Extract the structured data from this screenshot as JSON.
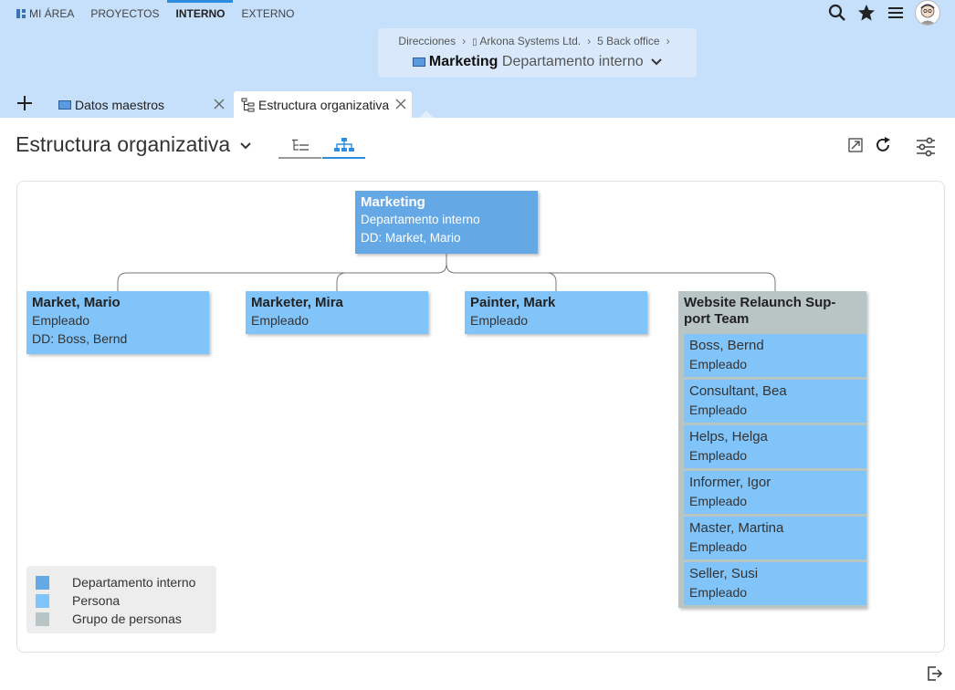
{
  "topnav": {
    "items": [
      {
        "label": "MI ÁREA",
        "active": false
      },
      {
        "label": "PROYECTOS",
        "active": false
      },
      {
        "label": "INTERNO",
        "active": true
      },
      {
        "label": "EXTERNO",
        "active": false
      }
    ],
    "icons": [
      "search-icon",
      "star-icon",
      "menu-icon",
      "avatar"
    ]
  },
  "breadcrumb": {
    "items": [
      "Direcciones",
      "Arkona Systems Ltd.",
      "5 Back office"
    ],
    "title": "Marketing",
    "subtitle": "Departamento interno"
  },
  "tabs": [
    {
      "label": "Datos maestros",
      "icon": "department-icon",
      "active": false
    },
    {
      "label": "Estructura organizativa",
      "icon": "org-tree-icon",
      "active": true
    }
  ],
  "page": {
    "title": "Estructura organizativa",
    "views": [
      "list-view-icon",
      "org-chart-view-icon"
    ],
    "tools": [
      "expand-icon",
      "refresh-icon",
      "settings-sliders-icon"
    ]
  },
  "org": {
    "root": {
      "name": "Marketing",
      "type": "Departamento interno",
      "dd": "DD: Market, Mario"
    },
    "children": [
      {
        "name": "Market, Mario",
        "role": "Empleado",
        "dd": "DD: Boss, Bernd"
      },
      {
        "name": "Marketer, Mira",
        "role": "Empleado"
      },
      {
        "name": "Painter, Mark",
        "role": "Empleado"
      }
    ],
    "group": {
      "name": "Website Relaunch Sup-port Team",
      "members": [
        {
          "name": "Boss, Bernd",
          "role": "Empleado"
        },
        {
          "name": "Consultant, Bea",
          "role": "Empleado"
        },
        {
          "name": "Helps, Helga",
          "role": "Empleado"
        },
        {
          "name": "Informer, Igor",
          "role": "Empleado"
        },
        {
          "name": "Master, Martina",
          "role": "Empleado"
        },
        {
          "name": "Seller, Susi",
          "role": "Empleado"
        }
      ]
    }
  },
  "legend": [
    {
      "label": "Departamento interno",
      "color": "#65a8e6"
    },
    {
      "label": "Persona",
      "color": "#80c4fa"
    },
    {
      "label": "Grupo de personas",
      "color": "#b9c4c5"
    }
  ],
  "colors": {
    "header": "#c6dffa",
    "accent": "#2d8ee0",
    "department": "#65a8e6",
    "person": "#80c4fa",
    "group": "#b9c4c5"
  }
}
